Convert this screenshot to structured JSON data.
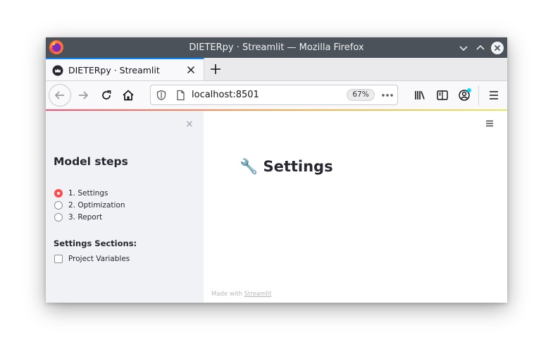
{
  "window": {
    "title": "DIETERpy · Streamlit — Mozilla Firefox"
  },
  "tabs": [
    {
      "label": "DIETERpy · Streamlit",
      "active": true
    }
  ],
  "navbar": {
    "url": "localhost:8501",
    "zoom": "67%"
  },
  "sidebar": {
    "close_glyph": "×",
    "title": "Model steps",
    "steps": [
      {
        "label": "1. Settings",
        "selected": true
      },
      {
        "label": "2. Optimization",
        "selected": false
      },
      {
        "label": "3. Report",
        "selected": false
      }
    ],
    "sections_heading": "Settings Sections:",
    "sections": [
      {
        "label": "Project Variables",
        "checked": false
      }
    ]
  },
  "main": {
    "title_icon": "🔧",
    "title": "Settings",
    "footer_prefix": "Made with",
    "footer_link": "Streamlit"
  },
  "colors": {
    "accent": "#ff4b4b",
    "sidebar_bg": "#f0f2f6",
    "titlebar_bg": "#4b5259",
    "tab_accent": "#0a84ff"
  }
}
